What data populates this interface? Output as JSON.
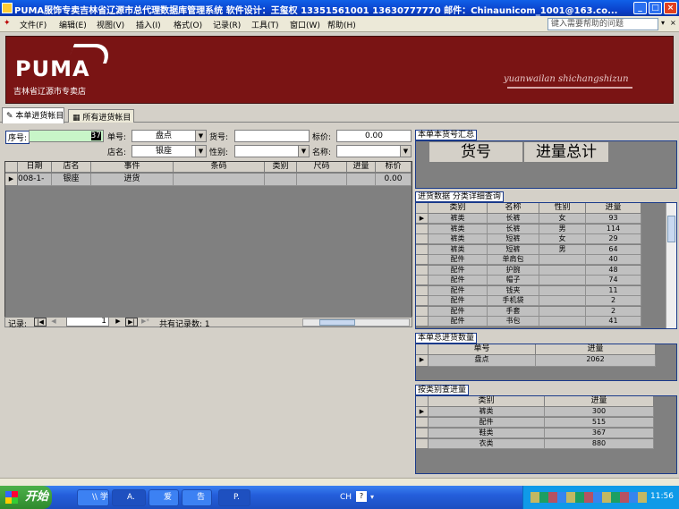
{
  "window": {
    "title": "PUMA服饰专卖吉林省辽源市总代理数据库管理系统   软件设计：王玺权   13351561001   13630777770   邮件：Chinaunicom_1001@163.co..."
  },
  "menu": [
    "文件(F)",
    "编辑(E)",
    "视图(V)",
    "插入(I)",
    "格式(O)",
    "记录(R)",
    "工具(T)",
    "窗口(W)",
    "帮助(H)"
  ],
  "help": {
    "placeholder": "键入需要帮助的问题"
  },
  "banner": {
    "logo": "PUMA",
    "store": "吉林省辽源市专卖店",
    "script": "yuanwailan  shichangshizun"
  },
  "tabs": [
    "本单进货帐目",
    "所有进货帐目"
  ],
  "form": {
    "seq_label": "序号:",
    "seq_value": "37",
    "order_label": "单号:",
    "order_value": "盘点",
    "item_label": "货号:",
    "item_value": "",
    "price_label": "标价:",
    "price_value": "0.00",
    "shop_label": "店名:",
    "shop_value": "银座",
    "gender_label": "性别:",
    "gender_value": "",
    "name_label": "名称:",
    "name_value": ""
  },
  "main_grid": {
    "headers": [
      "日期",
      "店名",
      "事件",
      "条码",
      "类别",
      "尺码",
      "进量",
      "标价"
    ],
    "row": [
      "008-1-",
      "银座",
      "进货",
      "",
      "",
      "",
      "",
      "0.00"
    ]
  },
  "nav": {
    "label": "记录:",
    "current": "1",
    "total_label": "共有记录数: 1"
  },
  "summary": {
    "title": "本单本货号汇总",
    "col1": "货号",
    "col2": "进量总计"
  },
  "detail": {
    "title": "进货数据 分类详细查询",
    "headers": [
      "类别",
      "名称",
      "性别",
      "进量"
    ],
    "rows": [
      [
        "裤类",
        "长裤",
        "女",
        "93"
      ],
      [
        "裤类",
        "长裤",
        "男",
        "114"
      ],
      [
        "裤类",
        "短裤",
        "女",
        "29"
      ],
      [
        "裤类",
        "短裤",
        "男",
        "64"
      ],
      [
        "配件",
        "单肩包",
        "",
        "40"
      ],
      [
        "配件",
        "护腕",
        "",
        "48"
      ],
      [
        "配件",
        "帽子",
        "",
        "74"
      ],
      [
        "配件",
        "钱夹",
        "",
        "11"
      ],
      [
        "配件",
        "手机袋",
        "",
        "2"
      ],
      [
        "配件",
        "手套",
        "",
        "2"
      ],
      [
        "配件",
        "书包",
        "",
        "41"
      ]
    ]
  },
  "order_total": {
    "title": "本单总进货数量",
    "headers": [
      "单号",
      "进量"
    ],
    "row": [
      "盘点",
      "2062"
    ]
  },
  "by_category": {
    "title": "按类别查进量",
    "headers": [
      "类别",
      "进量"
    ],
    "rows": [
      [
        "裤类",
        "300"
      ],
      [
        "配件",
        "515"
      ],
      [
        "鞋类",
        "367"
      ],
      [
        "衣类",
        "880"
      ]
    ]
  },
  "taskbar": {
    "start": "开始",
    "tasks": [
      "\\\\ 学",
      "A.",
      "爱",
      "告",
      "P."
    ],
    "lang": "CH",
    "clock": "11:56"
  }
}
